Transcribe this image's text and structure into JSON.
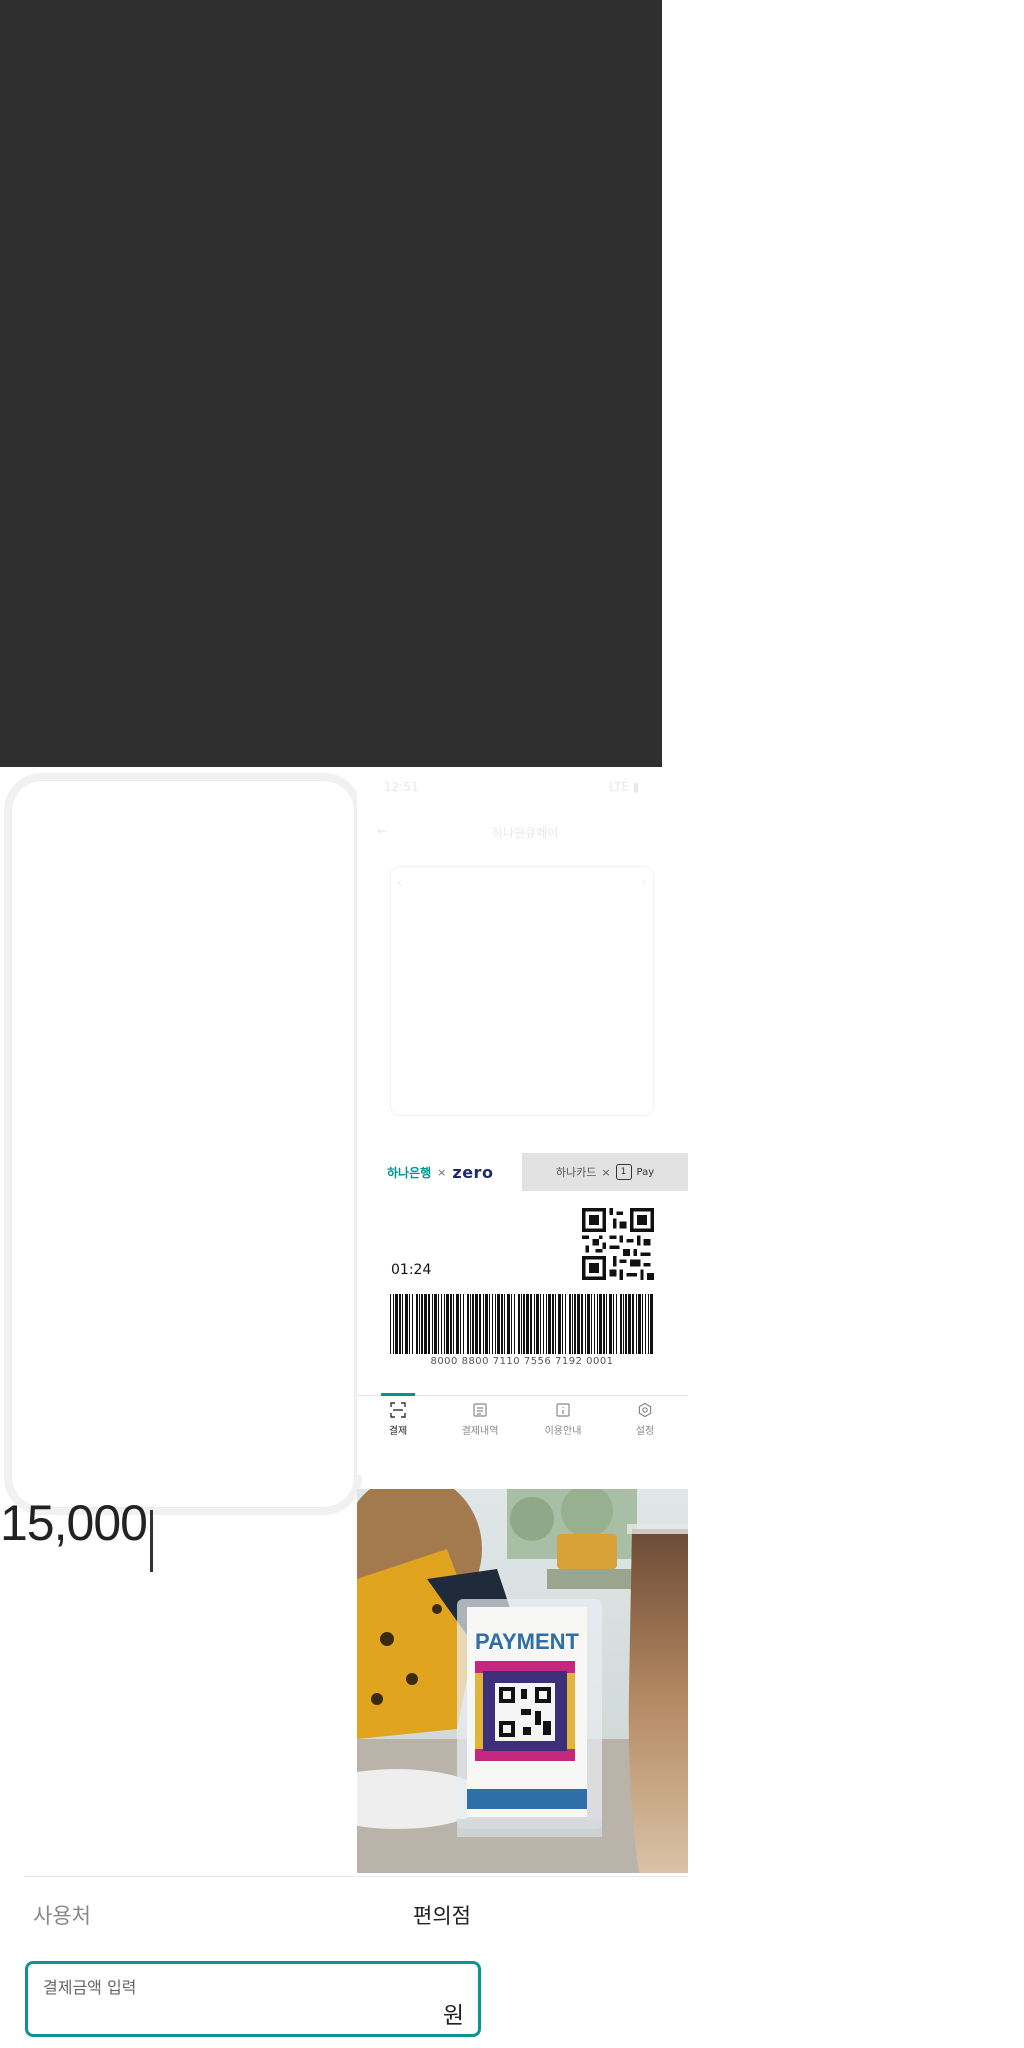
{
  "pay_screen": {
    "faint_header_left": "12:51",
    "faint_header_right": "LTE ▮",
    "faint_title": "하나원큐페이",
    "faint_back": "←",
    "brand_tab": {
      "bank": "하나은행",
      "times": "×",
      "zero": "zero"
    },
    "card_tab": {
      "card": "하나카드",
      "times": "×",
      "pay": "Pay"
    },
    "timer": "01:24",
    "barcode_number": "8000  8800  7110  7556  7192  0001",
    "nav": [
      {
        "label": "결제",
        "icon": "scan-icon"
      },
      {
        "label": "결제내역",
        "icon": "receipt-icon"
      },
      {
        "label": "이용안내",
        "icon": "info-icon"
      },
      {
        "label": "설정",
        "icon": "gear-icon"
      }
    ]
  },
  "photo": {
    "sign_text": "PAYMENT"
  },
  "amount": {
    "value": "15,000"
  },
  "merchant": {
    "label": "사용처",
    "value": "편의점"
  },
  "amount_input": {
    "label": "결제금액 입력",
    "unit": "원"
  },
  "colors": {
    "accent": "#0d9490",
    "dark_panel": "#2f2f2f"
  }
}
